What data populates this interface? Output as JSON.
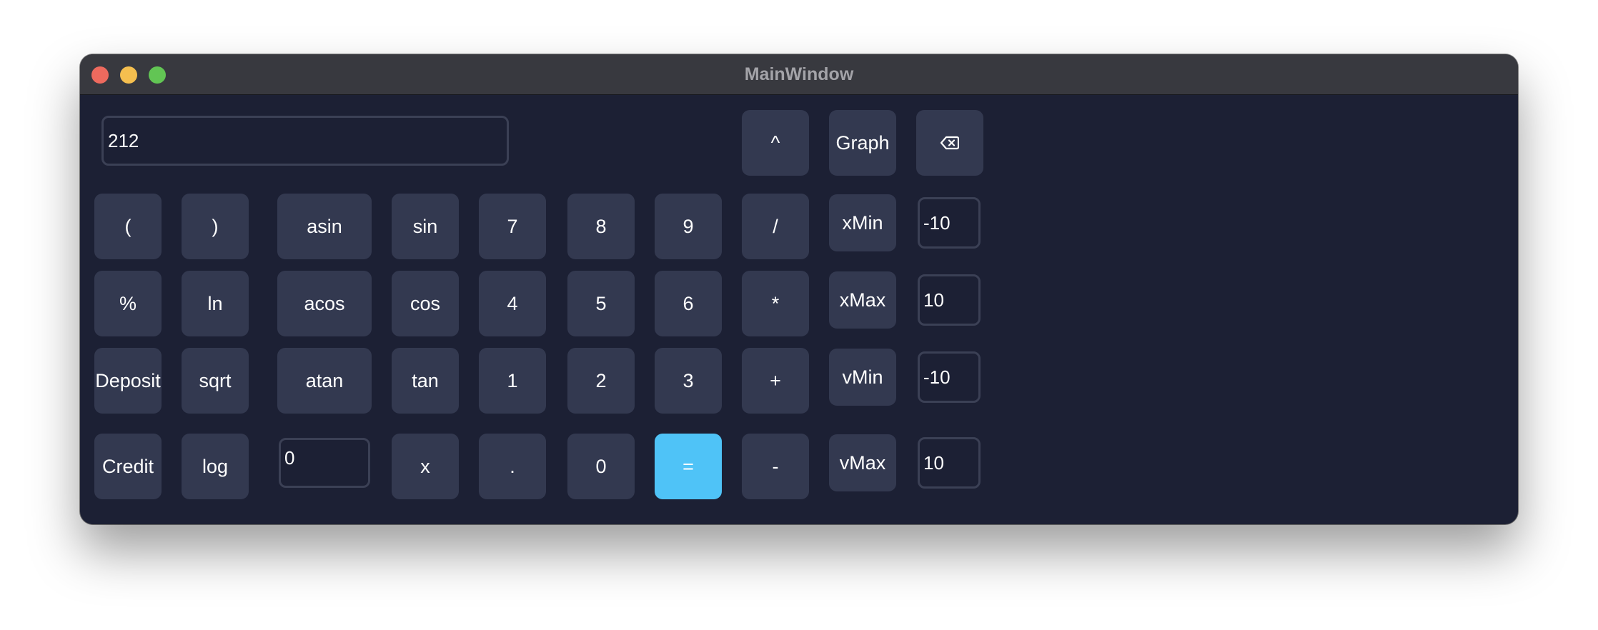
{
  "window": {
    "title": "MainWindow"
  },
  "display": {
    "value": "212"
  },
  "buttons": {
    "power": "^",
    "graph": "Graph",
    "backspace_icon": "backspace-icon",
    "lparen": "(",
    "rparen": ")",
    "asin": "asin",
    "sin": "sin",
    "seven": "7",
    "eight": "8",
    "nine": "9",
    "divide": "/",
    "percent": "%",
    "ln": "ln",
    "acos": "acos",
    "cos": "cos",
    "four": "4",
    "five": "5",
    "six": "6",
    "multiply": "*",
    "deposit": "Deposit",
    "sqrt": "sqrt",
    "atan": "atan",
    "tan": "tan",
    "one": "1",
    "two": "2",
    "three": "3",
    "plus": "+",
    "credit": "Credit",
    "log": "log",
    "x": "x",
    "dot": ".",
    "zero": "0",
    "equals": "=",
    "minus": "-"
  },
  "x_value_field": {
    "value": "0"
  },
  "graph_range": {
    "xmin_label": "xMin",
    "xmin_value": "-10",
    "xmax_label": "xMax",
    "xmax_value": "10",
    "vmin_label": "vMin",
    "vmin_value": "-10",
    "vmax_label": "vMax",
    "vmax_value": "10"
  },
  "colors": {
    "window_bg": "#1c2034",
    "button_bg": "#333950",
    "equals_bg": "#4fc3f7",
    "titlebar_bg": "#38393f"
  },
  "chart_data": {
    "type": "line",
    "series": [],
    "xlim": [
      0,
      5
    ],
    "ylim": [
      0,
      5
    ],
    "x_ticks": [
      "0",
      "1",
      "2",
      "3",
      "4",
      "5"
    ],
    "y_ticks": [
      "0",
      "1",
      "2",
      "3",
      "4",
      "5"
    ],
    "grid": true,
    "title": "",
    "xlabel": "",
    "ylabel": ""
  }
}
